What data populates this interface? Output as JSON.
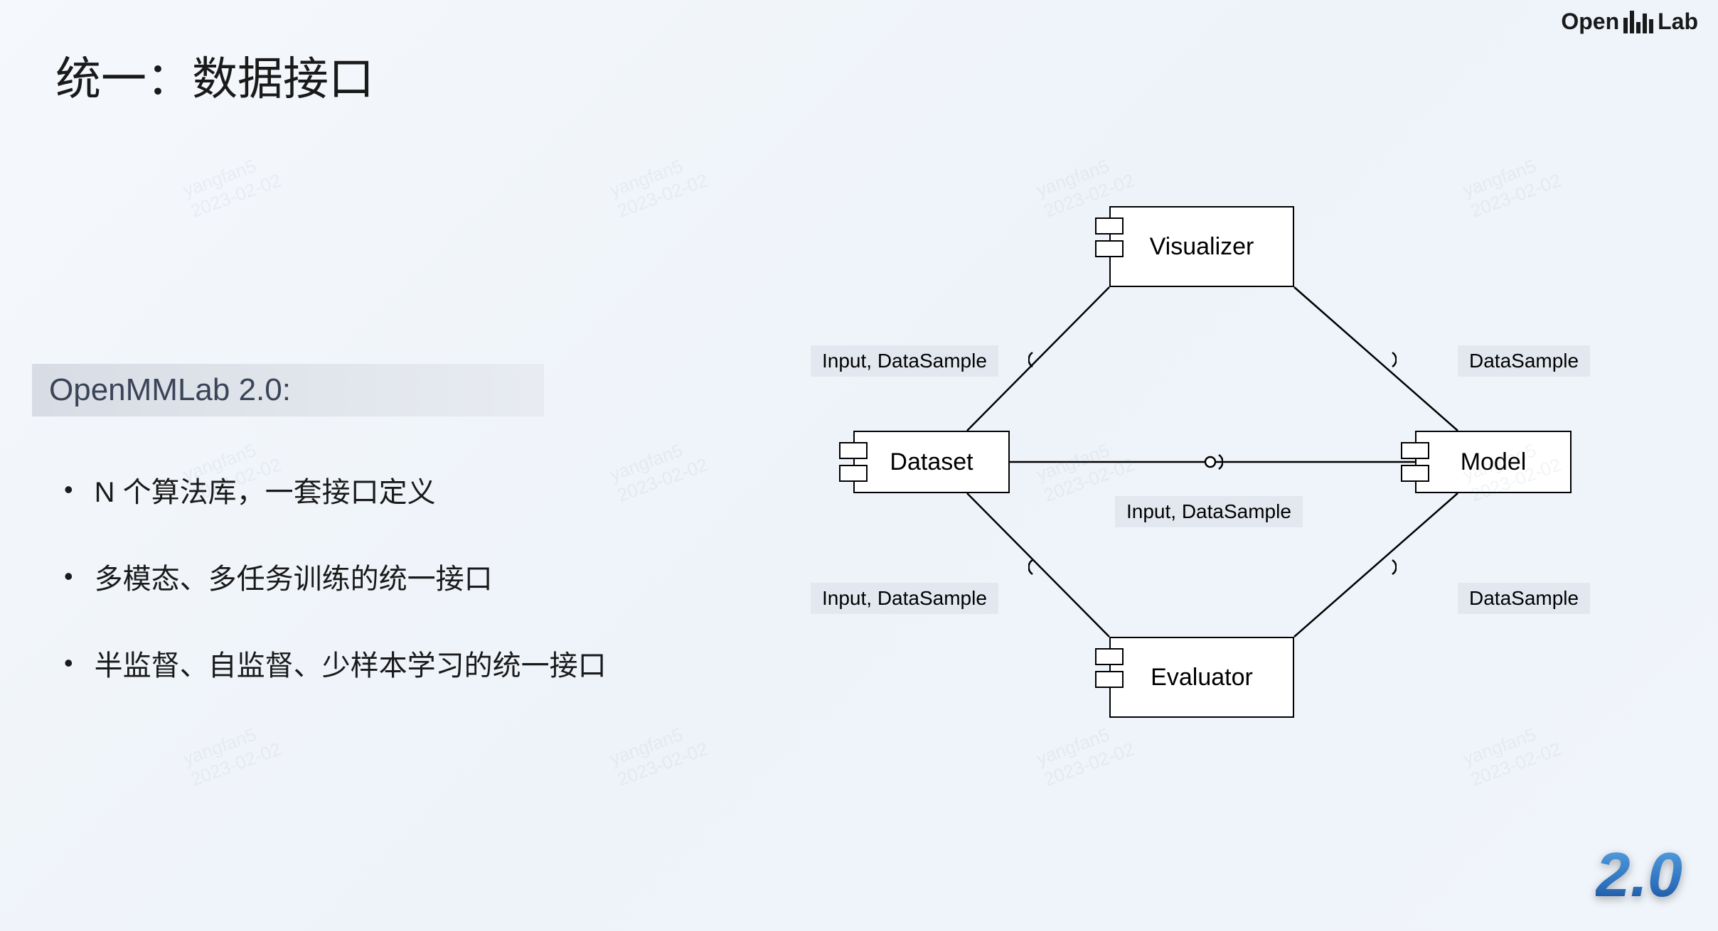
{
  "title": "统一：数据接口",
  "logo": {
    "prefix": "Open",
    "suffix": "Lab"
  },
  "subtitle": "OpenMMLab 2.0:",
  "bullets": [
    "N 个算法库，一套接口定义",
    "多模态、多任务训练的统一接口",
    "半监督、自监督、少样本学习的统一接口"
  ],
  "diagram": {
    "boxes": {
      "visualizer": "Visualizer",
      "dataset": "Dataset",
      "model": "Model",
      "evaluator": "Evaluator"
    },
    "edge_labels": {
      "tl": "Input, DataSample",
      "tr": "DataSample",
      "mid": "Input, DataSample",
      "bl": "Input, DataSample",
      "br": "DataSample"
    }
  },
  "version": "2.0",
  "watermark": {
    "line1": "yangfan5",
    "line2": "2023-02-02"
  }
}
